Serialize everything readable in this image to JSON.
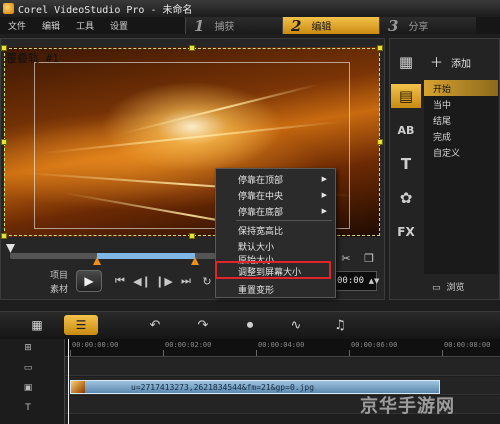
{
  "window": {
    "title": "Corel VideoStudio Pro - 未命名"
  },
  "menu": [
    "文件",
    "编辑",
    "工具",
    "设置"
  ],
  "steps": [
    {
      "num": "1",
      "label": "捕获",
      "active": false
    },
    {
      "num": "2",
      "label": "编辑",
      "active": true
    },
    {
      "num": "3",
      "label": "分享",
      "active": false
    }
  ],
  "preview": {
    "overlay_label": "覆叠轨 #1",
    "project_label": "项目",
    "clip_label": "素材",
    "timecode": "00:00"
  },
  "context_menu": {
    "items": [
      {
        "label": "停靠在顶部",
        "submenu": true
      },
      {
        "label": "停靠在中央",
        "submenu": true
      },
      {
        "label": "停靠在底部",
        "submenu": true
      },
      {
        "label": "保持宽高比",
        "submenu": false
      },
      {
        "label": "默认大小",
        "submenu": false
      },
      {
        "label": "原始大小",
        "submenu": false
      },
      {
        "label": "调整到屏幕大小",
        "submenu": false,
        "highlighted": true
      },
      {
        "label": "重置变形",
        "submenu": false
      }
    ],
    "highlight_color": "#e0242c"
  },
  "library": {
    "add_label": "添加",
    "categories": [
      "开始",
      "当中",
      "结尾",
      "完成",
      "自定义"
    ],
    "active_category": "开始",
    "browse_label": "浏览",
    "icons": [
      "film-icon",
      "title-icon-ab",
      "text-icon",
      "graphic-icon",
      "fx-icon"
    ]
  },
  "timeline": {
    "ruler_labels": [
      "00:00:00:00",
      "00:00:02:00",
      "00:00:04:00",
      "00:00:06:00",
      "00:00:08:00"
    ],
    "clip_name": "u=2717413273,2621834544&fm=21&gp=0.jpg"
  },
  "watermark": "京华手游网",
  "colors": {
    "accent": "#e8b030",
    "clip": "#7ea9cc"
  }
}
